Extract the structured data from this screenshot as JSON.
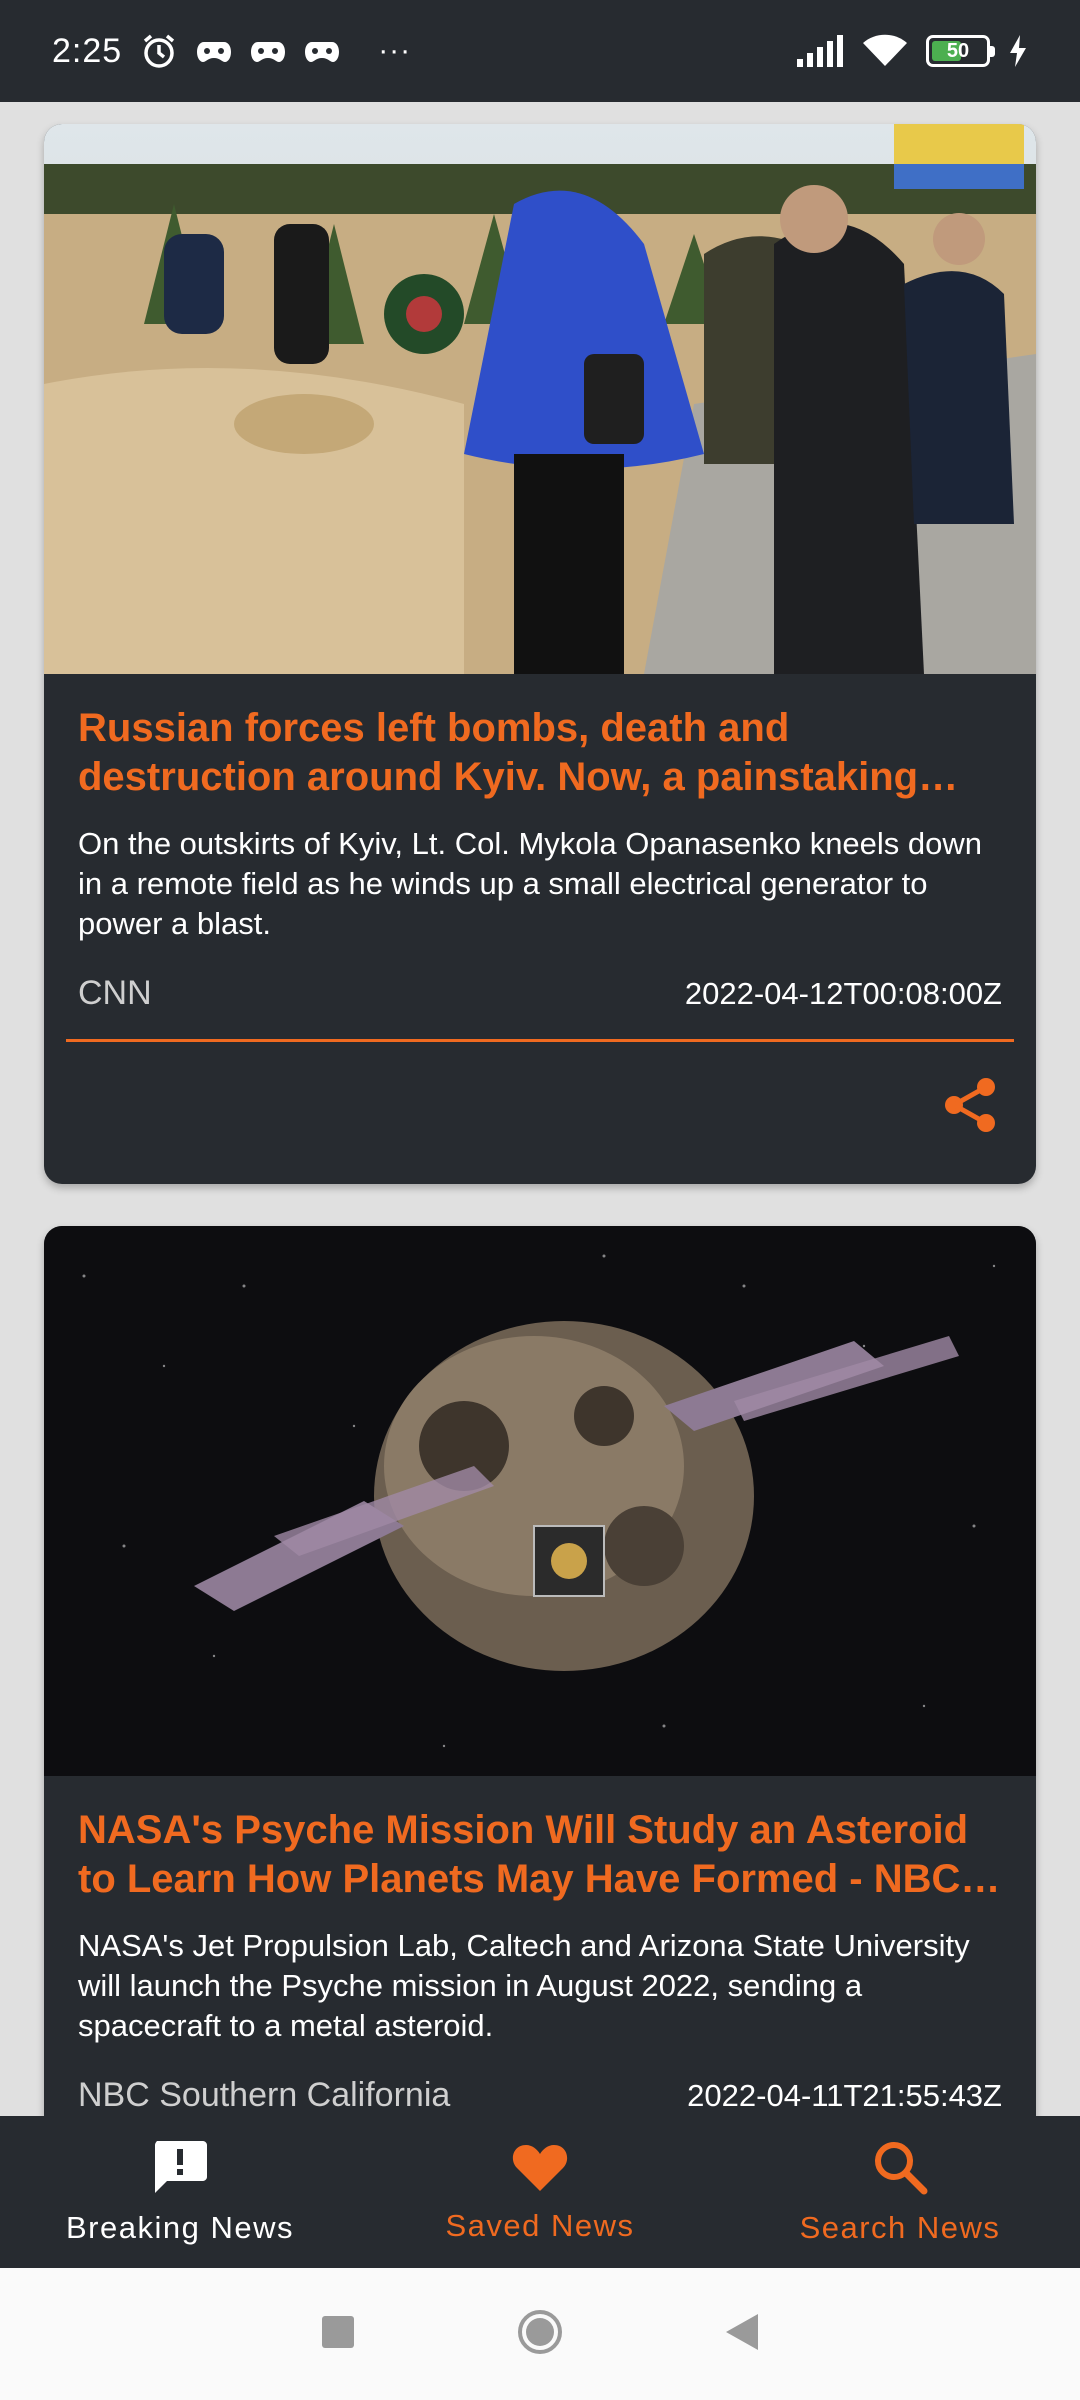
{
  "status_bar": {
    "time": "2:25",
    "battery_level": "50",
    "more": "···"
  },
  "articles": [
    {
      "title": "Russian forces left bombs, death and destruction around Kyiv. Now, a painstaking demining oper...",
      "description": "On the outskirts of Kyiv, Lt. Col. Mykola Opanasenko kneels down in a remote field as he winds up a small electrical generator to power a blast.",
      "source": "CNN",
      "published_at": "2022-04-12T00:08:00Z"
    },
    {
      "title": "NASA's Psyche Mission Will Study an Asteroid to Learn How Planets May Have Formed - NBC S...",
      "description": "NASA's Jet Propulsion Lab, Caltech and Arizona State University will launch the Psyche mission in August 2022, sending a spacecraft to a metal asteroid.",
      "source": "NBC Southern California",
      "published_at": "2022-04-11T21:55:43Z"
    }
  ],
  "bottom_nav": {
    "items": [
      {
        "label": "Breaking News",
        "icon": "alert-message-icon",
        "selected": true
      },
      {
        "label": "Saved News",
        "icon": "heart-icon",
        "selected": false
      },
      {
        "label": "Search News",
        "icon": "search-icon",
        "selected": false
      }
    ]
  },
  "colors": {
    "accent": "#f06a20",
    "card_background": "#272b30",
    "page_background": "#e0e0e0"
  }
}
